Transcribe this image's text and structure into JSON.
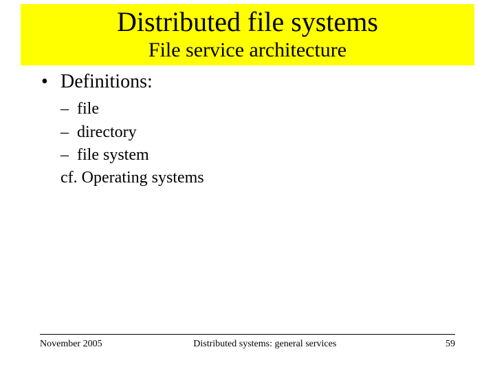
{
  "title": "Distributed file systems",
  "subtitle": "File service architecture",
  "bullets": {
    "l1": "Definitions:",
    "sub": {
      "a": "file",
      "b": "directory",
      "c": "file system",
      "d": "cf. Operating systems"
    }
  },
  "footer": {
    "left": "November 2005",
    "center": "Distributed systems: general services",
    "right": "59"
  }
}
